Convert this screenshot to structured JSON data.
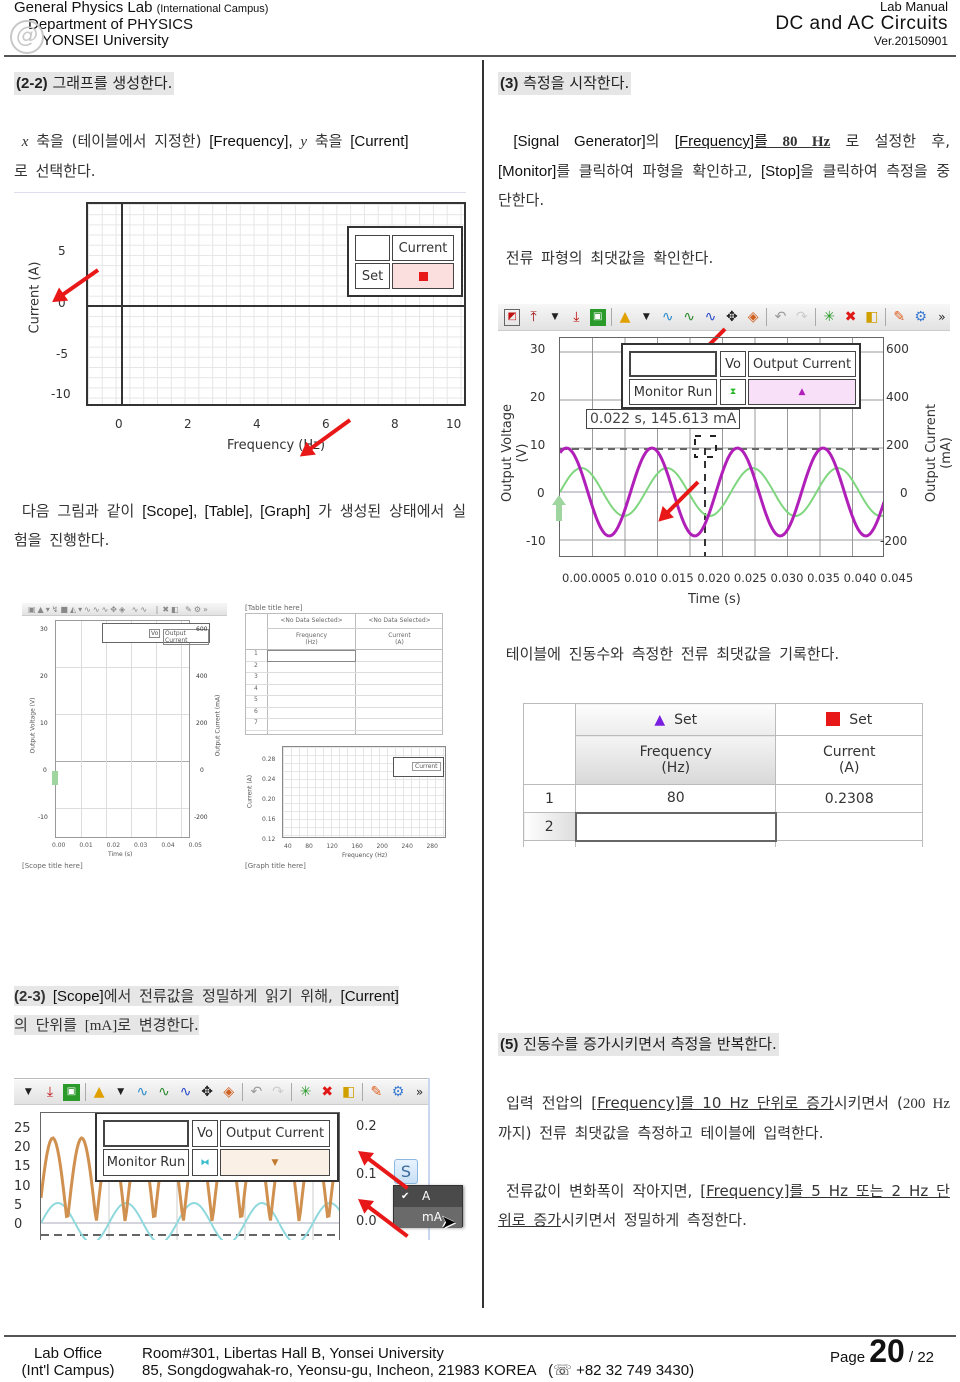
{
  "header": {
    "left_line1": "General Physics Lab",
    "left_line1_small": "(International Campus)",
    "left_line2": "Department of PHYSICS",
    "left_line3": "YONSEI University",
    "logo_glyph": "@",
    "right_line1": "Lab Manual",
    "right_line2": "DC and AC Circuits",
    "right_line3": "Ver.20150901"
  },
  "left": {
    "sec_2_2": {
      "num": "(2-2)",
      "title": "그래프를 생성한다."
    },
    "para1": {
      "x": "x",
      "t1": " 축을 (테이블에서 지정한) ",
      "freq": "[Frequency],",
      "y": "y",
      "t2": " 축을 ",
      "cur": "[Current]",
      "t3": "로 선택한다."
    },
    "graph1": {
      "ylabel": "Current (A)",
      "xlabel": "Frequency (Hz)",
      "yticks": [
        "5",
        "0",
        "-5",
        "-10"
      ],
      "xticks": [
        "0",
        "2",
        "4",
        "6",
        "8",
        "10"
      ],
      "legend_header": "Current",
      "legend_row": "Set",
      "legend_marker_color": "#e81818"
    },
    "para2": {
      "t1": "다음 그림과 같이 ",
      "en": "[Scope], [Table], [Graph]",
      "t2": " 가 생성된 상태에서 실험을 진행한다."
    },
    "mini_scope": {
      "legend": [
        "Vo",
        "Output Current"
      ],
      "yticks_left": [
        "30",
        "20",
        "10",
        "0",
        "-10"
      ],
      "yticks_right": [
        "600",
        "400",
        "200",
        "0",
        "-200"
      ],
      "xticks": [
        "0.00",
        "0.01",
        "0.02",
        "0.03",
        "0.04",
        "0.05"
      ],
      "ylabel_left": "Output Voltage (V)",
      "ylabel_right": "Output Current (mA)",
      "xlabel": "Time (s)",
      "caption": "[Scope title here]"
    },
    "mini_table": {
      "title": "[Table title here]",
      "headers_top": [
        "<No Data Selected>",
        "<No Data Selected>"
      ],
      "headers": [
        "Frequency\n(Hz)",
        "Current\n(A)"
      ],
      "rows": [
        "1",
        "2",
        "3",
        "4",
        "5",
        "6",
        "7"
      ]
    },
    "mini_graph": {
      "yticks": [
        "0.28",
        "0.24",
        "0.20",
        "0.16",
        "0.12"
      ],
      "xticks": [
        "40",
        "80",
        "120",
        "160",
        "200",
        "240",
        "280"
      ],
      "ylabel": "Current (A)",
      "xlabel": "Frequency (Hz)",
      "legend": "Current",
      "caption": "[Graph title here]"
    },
    "sec_2_3": {
      "num": "(2-3)",
      "t1": " [Scope]",
      "t2": "에서 전류값을 정밀하게 읽기 위해, ",
      "cur": "[Current]",
      "t3": "의 단위를 ",
      "ma": "[mA]",
      "t4": "로 변경한다."
    },
    "scope2": {
      "yticks_left": [
        "25",
        "20",
        "15",
        "10",
        "5",
        "0"
      ],
      "yticks_right": [
        "0.2",
        "0.1",
        "0.0"
      ],
      "legend_col1": "Vo",
      "legend_col2": "Output Current",
      "legend_row": "Monitor Run",
      "menu_items": [
        "A",
        "mA"
      ],
      "menu_checked": "A",
      "menu_hover": "mA",
      "unit_button_glyph": "S"
    }
  },
  "right": {
    "sec_3": {
      "num": "(3)",
      "title": "측정을 시작한다."
    },
    "para1": {
      "sg": "[Signal Generator]",
      "t1": "의 ",
      "freq": "[Frequency]를 ",
      "val": "80 Hz",
      "t2": " 로 설정한 후, ",
      "mon": "[Monitor]",
      "t3": "를 클릭하여 파형을 확인하고, ",
      "stop": "[Stop]",
      "t4": "을 클릭하여 측정을 중단한다."
    },
    "para2": "전류 파형의 최댓값을 확인한다.",
    "scope": {
      "legend_col1": "Vo",
      "legend_col2": "Output Current",
      "legend_row": "Monitor Run",
      "tooltip": "0.022 s, 145.613 mA",
      "yticks_left": [
        "30",
        "20",
        "10",
        "0",
        "-10"
      ],
      "yticks_right": [
        "600",
        "400",
        "200",
        "0",
        "-200"
      ],
      "xticks_label": "0.00.0005 0.010 0.015 0.020 0.025 0.030 0.035 0.040 0.045",
      "xticks": [
        "0.000",
        "0.005",
        "0.010",
        "0.015",
        "0.020",
        "0.025",
        "0.030",
        "0.035",
        "0.040",
        "0.045"
      ],
      "ylabel_left": "Output Voltage (V)",
      "ylabel_right": "Output Current (mA)",
      "xlabel": "Time (s)",
      "voltage_color": "#7fd67f",
      "current_color": "#b020b8",
      "more_glyph": "»"
    },
    "para3": "테이블에 진동수와 측정한 전류 최댓값을 기록한다.",
    "table": {
      "set_labels": [
        "Set",
        "Set"
      ],
      "set_colors": [
        "#7a1fe0",
        "#e81818"
      ],
      "headers": [
        "Frequency",
        "Current"
      ],
      "units": [
        "(Hz)",
        "(A)"
      ],
      "rows": [
        {
          "n": "1",
          "freq": "80",
          "cur": "0.2308"
        },
        {
          "n": "2",
          "freq": "",
          "cur": ""
        }
      ]
    },
    "sec_5": {
      "num": "(5)",
      "title": "진동수를 증가시키면서 측정을 반복한다."
    },
    "para4": {
      "t1": "입력 전압의 ",
      "u1": "[Frequency]를 10 Hz 단위로 증가",
      "t2": "시키면서 (",
      "v1": "200 Hz",
      "t3": " 까지) 전류 최댓값을 측정하고 테이블에 입력한다."
    },
    "para5": {
      "t1": "전류값이 변화폭이 작아지면, ",
      "u1": "[Frequency]를 5 Hz 또는 2 Hz 단위로 증가",
      "t2": "시키면서 정밀하게 측정한다."
    }
  },
  "footer": {
    "office_l1": "Lab Office",
    "office_l2": "(Int'l Campus)",
    "addr_l1": "Room#301, Libertas Hall B, Yonsei University",
    "addr_l2": "85, Songdogwahak-ro, Yeonsu-gu, Incheon, 21983 KOREA",
    "phone": "(☏ +82 32 749 3430)",
    "page_label": "Page",
    "page_num": "20",
    "page_total": "/ 22"
  }
}
